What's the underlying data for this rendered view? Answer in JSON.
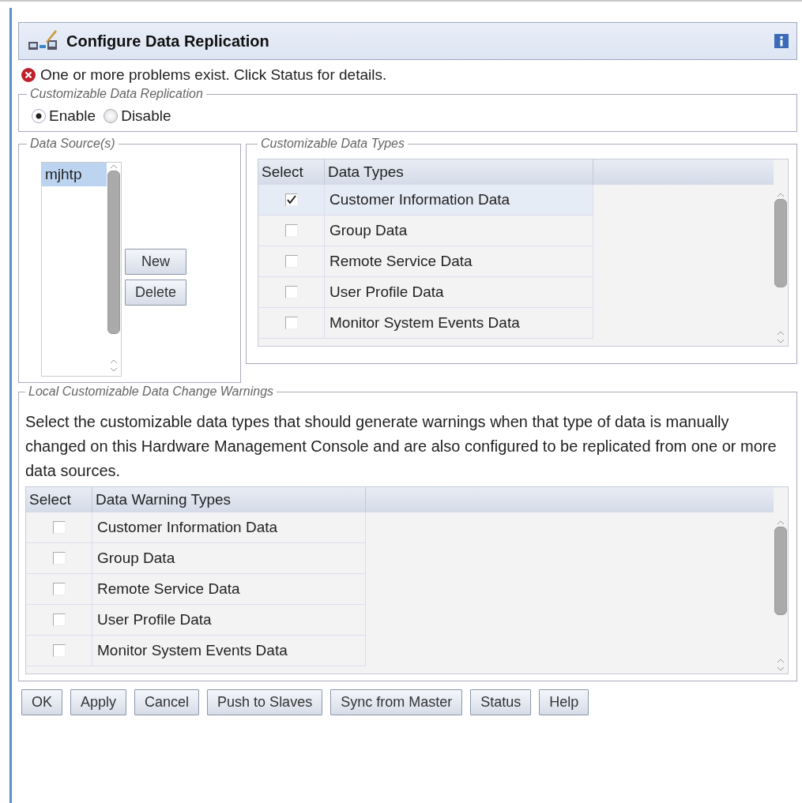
{
  "header": {
    "title": "Configure Data Replication"
  },
  "message": {
    "text": "One or more problems exist. Click Status for details."
  },
  "replication": {
    "legend": "Customizable Data Replication",
    "options": [
      {
        "label": "Enable",
        "selected": true
      },
      {
        "label": "Disable",
        "selected": false
      }
    ]
  },
  "data_sources": {
    "legend": "Data Source(s)",
    "items": [
      {
        "label": "mjhtp",
        "selected": true
      }
    ],
    "buttons": [
      "New",
      "Delete"
    ]
  },
  "data_types": {
    "legend": "Customizable Data Types",
    "columns": [
      "Select",
      "Data Types"
    ],
    "rows": [
      {
        "label": "Customer Information Data",
        "checked": true
      },
      {
        "label": "Group Data",
        "checked": false
      },
      {
        "label": "Remote Service Data",
        "checked": false
      },
      {
        "label": "User Profile Data",
        "checked": false
      },
      {
        "label": "Monitor System Events Data",
        "checked": false
      }
    ]
  },
  "warnings": {
    "legend": "Local Customizable Data Change Warnings",
    "description": "Select the customizable data types that should generate warnings when that type of data is manually changed on this Hardware Management Console and are also configured to be replicated from one or more data sources.",
    "columns": [
      "Select",
      "Data Warning Types"
    ],
    "rows": [
      {
        "label": "Customer Information Data",
        "checked": false
      },
      {
        "label": "Group Data",
        "checked": false
      },
      {
        "label": "Remote Service Data",
        "checked": false
      },
      {
        "label": "User Profile Data",
        "checked": false
      },
      {
        "label": "Monitor System Events Data",
        "checked": false
      }
    ]
  },
  "buttons": [
    "OK",
    "Apply",
    "Cancel",
    "Push to Slaves",
    "Sync from Master",
    "Status",
    "Help"
  ]
}
